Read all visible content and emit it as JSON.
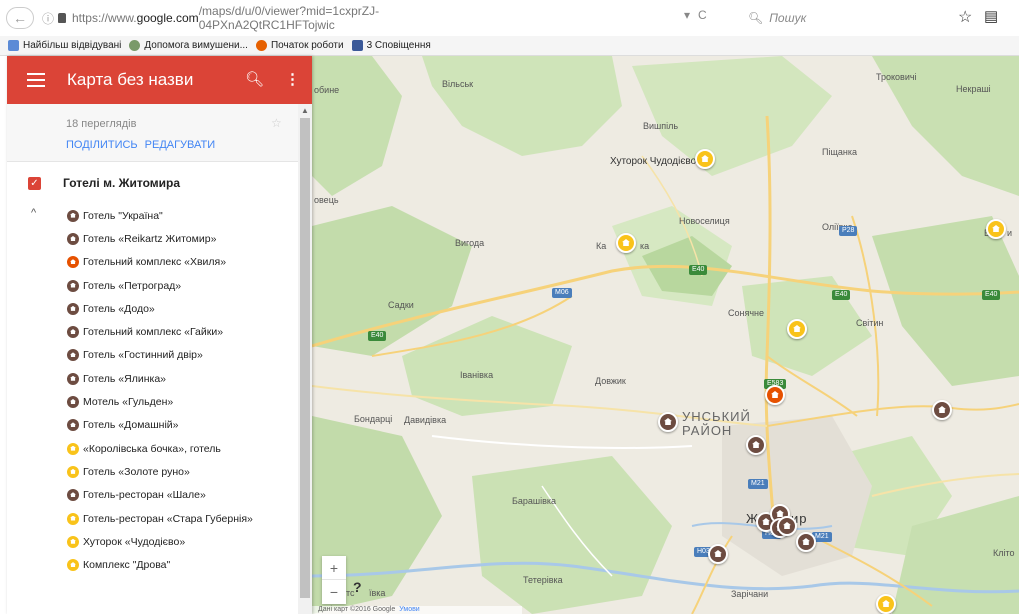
{
  "browser": {
    "url_prefix": "https://www.",
    "url_host": "google.com",
    "url_path": "/maps/d/u/0/viewer?mid=1cxprZJ-04PXnA2QtRC1HFTojwic",
    "search_placeholder": "Пошук"
  },
  "bookmarks": [
    {
      "label": "Найбільш відвідувані",
      "color": "#5c8bd6"
    },
    {
      "label": "Допомога вимушени...",
      "color": "#7a9a6a"
    },
    {
      "label": "Початок роботи",
      "color": "#e66000"
    },
    {
      "label": "3  Сповіщення",
      "color": "#3b5998"
    }
  ],
  "header": {
    "title": "Карта без назви"
  },
  "meta": {
    "views": "18 переглядів",
    "share_label": "ПОДІЛИТИСЬ",
    "edit_label": "РЕДАГУВАТИ"
  },
  "layer": {
    "name": "Готелі м. Житомира",
    "checked": true
  },
  "places": [
    {
      "name": "Готель \"Україна\"",
      "color": "#6d4c41"
    },
    {
      "name": "Готель «Reikartz Житомир»",
      "color": "#6d4c41"
    },
    {
      "name": "Готельний комплекс «Хвиля»",
      "color": "#e65100"
    },
    {
      "name": "Готель «Петроград»",
      "color": "#6d4c41"
    },
    {
      "name": "Готель «Додо»",
      "color": "#6d4c41"
    },
    {
      "name": "Готельний комплекс «Гайки»",
      "color": "#6d4c41"
    },
    {
      "name": "Готель «Гостинний двір»",
      "color": "#6d4c41"
    },
    {
      "name": "Готель «Ялинка»",
      "color": "#6d4c41"
    },
    {
      "name": "Мотель «Гульден»",
      "color": "#6d4c41"
    },
    {
      "name": "Готель «Домашній»",
      "color": "#6d4c41"
    },
    {
      "name": "«Королівська бочка», готель",
      "color": "#f9c31a"
    },
    {
      "name": "Готель «Золоте руно»",
      "color": "#f9c31a"
    },
    {
      "name": "Готель-ресторан «Шале»",
      "color": "#6d4c41"
    },
    {
      "name": "Готель-ресторан «Стара Губернія»",
      "color": "#f9c31a"
    },
    {
      "name": "Хуторок «Чудодієво»",
      "color": "#f9c31a"
    },
    {
      "name": "Комплекс \"Дрова\"",
      "color": "#f9c31a"
    }
  ],
  "map": {
    "labels": [
      {
        "text": "Вільськ"
      },
      {
        "text": "Троковичі"
      },
      {
        "text": "Некраші"
      },
      {
        "text": "Вишпіль"
      },
      {
        "text": "Піщанка"
      },
      {
        "text": "Хуторок Чудодієво"
      },
      {
        "text": "Новоселиця"
      },
      {
        "text": "Оліївка"
      },
      {
        "text": "Вигода"
      },
      {
        "text": "Ка"
      },
      {
        "text": "ка"
      },
      {
        "text": "Садки"
      },
      {
        "text": "Сонячне"
      },
      {
        "text": "Світин"
      },
      {
        "text": "Іванівка"
      },
      {
        "text": "Довжик"
      },
      {
        "text": "Бондарці"
      },
      {
        "text": "Давидівка"
      },
      {
        "text": "УНСЬКИЙ"
      },
      {
        "text": "РАЙОН"
      },
      {
        "text": "Барашівка"
      },
      {
        "text": "Тетерівка"
      },
      {
        "text": "Зарічани"
      },
      {
        "text": "Кліто"
      },
      {
        "text": "Ж"
      },
      {
        "text": "ир"
      },
      {
        "text": "обине"
      },
      {
        "text": "овець"
      },
      {
        "text": "В"
      },
      {
        "text": "и"
      },
      {
        "text": "тс"
      },
      {
        "text": "ївка"
      }
    ],
    "shields": [
      {
        "text": "P28",
        "color": "#4a7ebb"
      },
      {
        "text": "E40",
        "color": "#3a8a3a"
      },
      {
        "text": "M06",
        "color": "#4a7ebb"
      },
      {
        "text": "E40",
        "color": "#3a8a3a"
      },
      {
        "text": "E40",
        "color": "#3a8a3a"
      },
      {
        "text": "E40",
        "color": "#3a8a3a"
      },
      {
        "text": "E583",
        "color": "#3a8a3a"
      },
      {
        "text": "M21",
        "color": "#4a7ebb"
      },
      {
        "text": "H03",
        "color": "#4a7ebb"
      },
      {
        "text": "H03",
        "color": "#4a7ebb"
      },
      {
        "text": "M21",
        "color": "#4a7ebb"
      }
    ],
    "zoom_in": "+",
    "zoom_out": "−",
    "pegman": "?",
    "attribution": "Дані карт ©2016 Google",
    "terms": "Умови"
  }
}
